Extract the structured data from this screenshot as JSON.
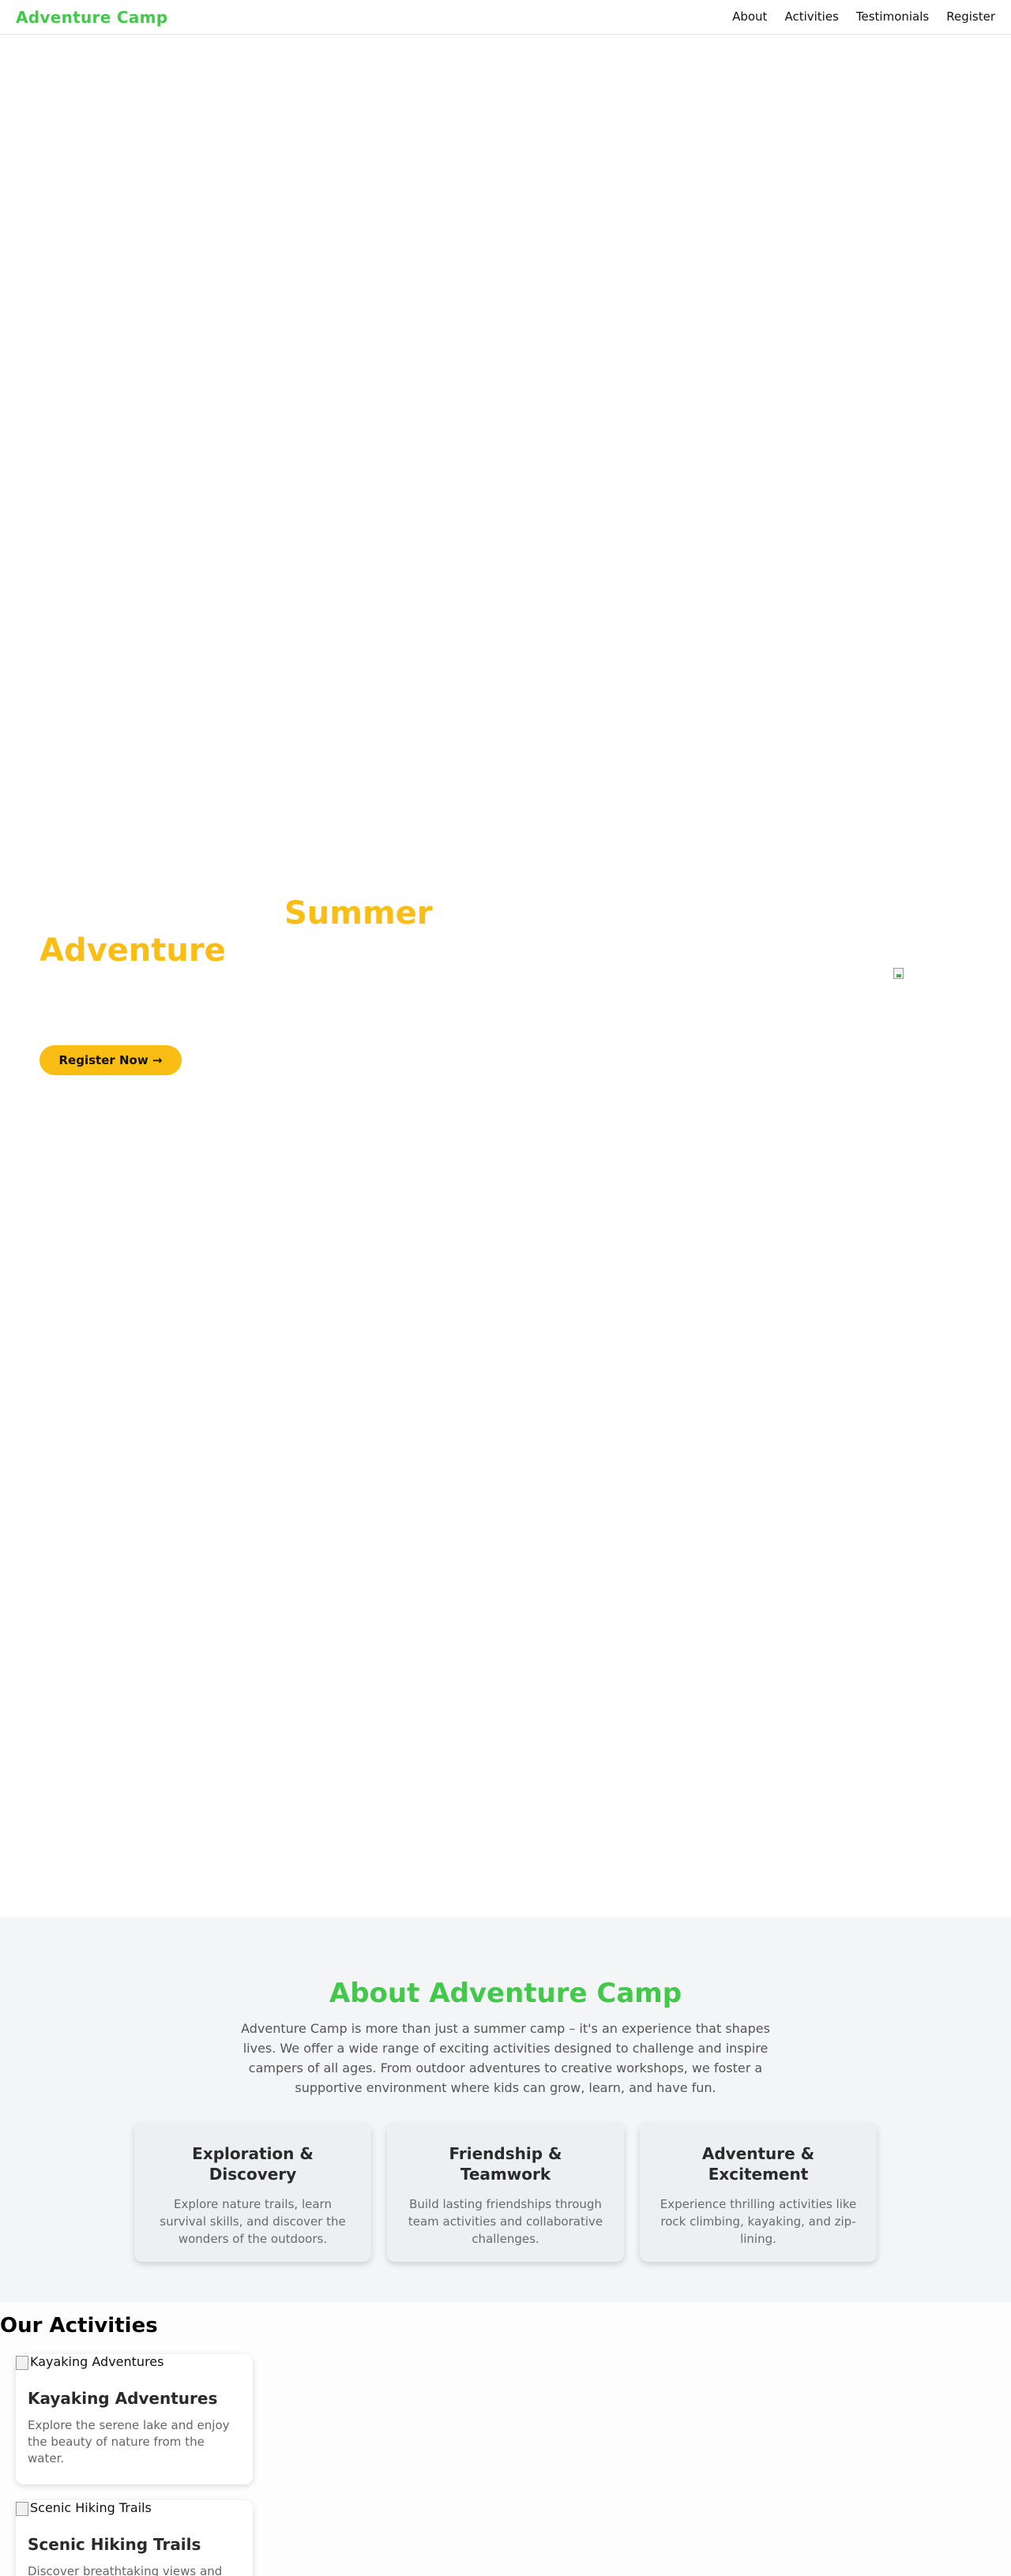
{
  "header": {
    "brand": "Adventure Camp",
    "nav": [
      "About",
      "Activities",
      "Testimonials",
      "Register"
    ]
  },
  "hero": {
    "word_1": "Summer",
    "word_2": "Adventure",
    "cta": "Register Now →",
    "image": "broken-image-icon"
  },
  "about": {
    "title": "About Adventure Camp",
    "intro": "Adventure Camp is more than just a summer camp – it's an experience that shapes lives. We offer a wide range of exciting activities designed to challenge and inspire campers of all ages. From outdoor adventures to creative workshops, we foster a supportive environment where kids can grow, learn, and have fun.",
    "cards": [
      {
        "title": "Exploration & Discovery",
        "text": "Explore nature trails, learn survival skills, and discover the wonders of the outdoors."
      },
      {
        "title": "Friendship & Teamwork",
        "text": "Build lasting friendships through team activities and collaborative challenges."
      },
      {
        "title": "Adventure & Excitement",
        "text": "Experience thrilling activities like rock climbing, kayaking, and zip-lining."
      }
    ]
  },
  "activities": {
    "title": "Our Activities",
    "items": [
      {
        "image_alt": "Kayaking Adventures",
        "name": "Kayaking Adventures",
        "desc": "Explore the serene lake and enjoy the beauty of nature from the water."
      },
      {
        "image_alt": "Scenic Hiking Trails",
        "name": "Scenic Hiking Trails",
        "desc": "Discover breathtaking views and"
      }
    ]
  },
  "colors": {
    "brand_green": "#43c94a",
    "accent_yellow": "#f9bd14"
  }
}
